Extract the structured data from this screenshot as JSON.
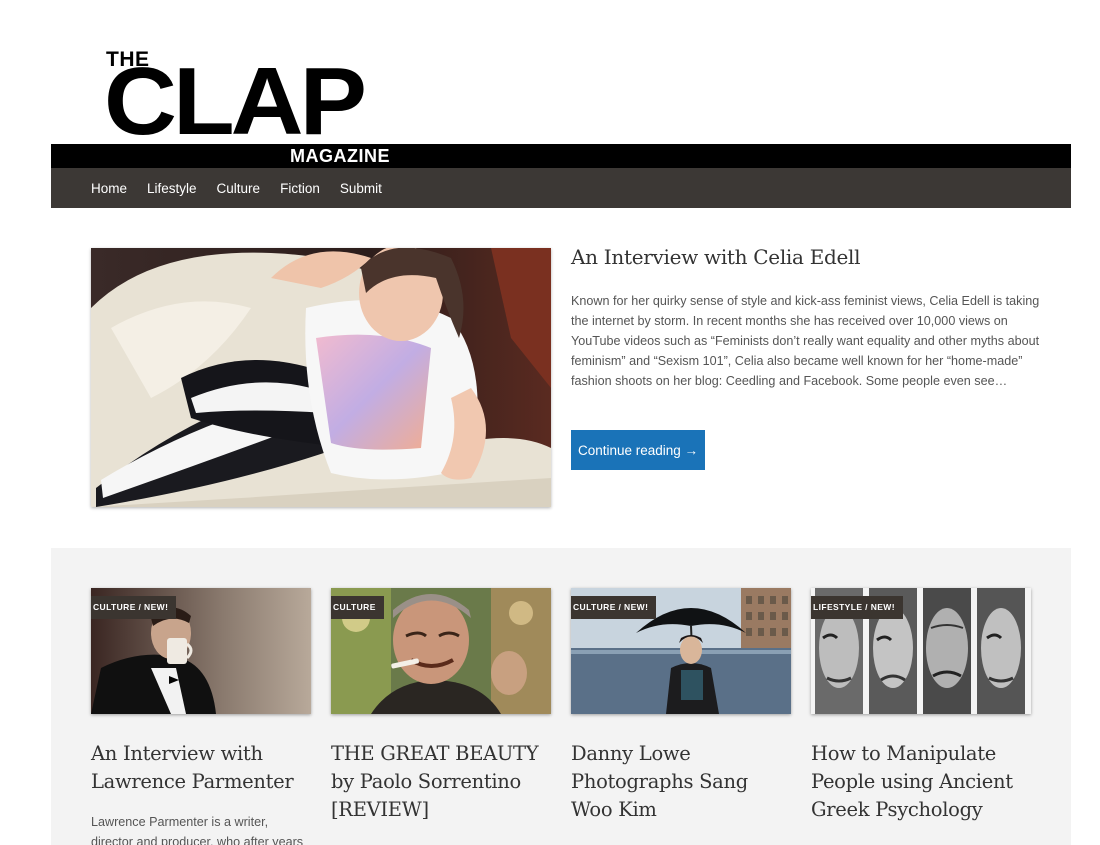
{
  "logo": {
    "the": "THE",
    "clap": "CLAP",
    "magazine": "MAGAZINE"
  },
  "nav": {
    "items": [
      "Home",
      "Lifestyle",
      "Culture",
      "Fiction",
      "Submit"
    ]
  },
  "featured": {
    "title": "An Interview with Celia Edell",
    "excerpt": "Known for her quirky sense of style and kick-ass feminist views, Celia Edell is taking the internet by storm. In recent months she has received over 10,000 views on YouTube videos such as “Feminists don’t really want equality and other myths about feminism” and “Sexism 101”, Celia also became well known for her “home-made” fashion shoots on her blog: Ceedling and Facebook. Some people even see…",
    "button": "Continue reading →"
  },
  "cards": [
    {
      "badge": "CULTURE / NEW!",
      "title": "An Interview with Lawrence Parmenter",
      "excerpt": "Lawrence Parmenter is a writer, director and producer, who after years"
    },
    {
      "badge": "CULTURE",
      "title": "THE GREAT BEAUTY by Paolo Sorrentino [REVIEW]",
      "excerpt": ""
    },
    {
      "badge": "CULTURE / NEW!",
      "title": "Danny Lowe Photographs Sang Woo Kim",
      "excerpt": ""
    },
    {
      "badge": "LIFESTYLE / NEW!",
      "title": "How to Manipulate People using Ancient Greek Psychology",
      "excerpt": ""
    }
  ]
}
